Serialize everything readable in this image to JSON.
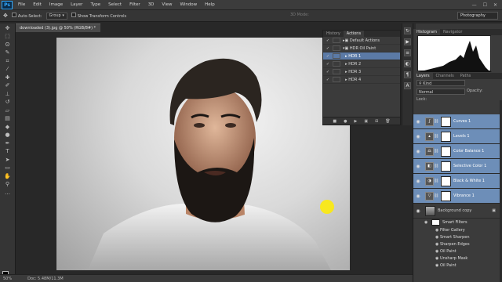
{
  "menubar": {
    "logo": "Ps",
    "items": [
      "File",
      "Edit",
      "Image",
      "Layer",
      "Type",
      "Select",
      "Filter",
      "3D",
      "View",
      "Window",
      "Help"
    ],
    "window_controls": [
      "—",
      "☐",
      "✕"
    ]
  },
  "options": {
    "auto_select": "Auto-Select:",
    "group_value": "Group",
    "transform_controls": "Show Transform Controls",
    "mode_3d": "3D Mode:",
    "workspace": "Photography"
  },
  "document": {
    "tab_title": "downloaded (3).jpg @ 50% (RGB/8#) *",
    "zoom": "50%",
    "doc_size": "Doc: 5.48M/11.3M"
  },
  "actions_panel": {
    "tabs": [
      "History",
      "Actions"
    ],
    "rows": [
      {
        "label": "Default Actions",
        "check": "✓",
        "selected": false
      },
      {
        "label": "HDR Oil Paint",
        "check": "✓",
        "selected": false
      },
      {
        "label": "HDR 1",
        "check": "✓",
        "selected": true
      },
      {
        "label": "HDR 2",
        "check": "✓",
        "selected": false
      },
      {
        "label": "HDR 3",
        "check": "✓",
        "selected": false
      },
      {
        "label": "HDR 4",
        "check": "✓",
        "selected": false
      }
    ]
  },
  "histogram_panel": {
    "tabs": [
      "Histogram",
      "Navigator"
    ]
  },
  "layers_panel": {
    "tabs": [
      "Layers",
      "Channels",
      "Paths"
    ],
    "filter_kind": "Kind",
    "blend_mode": "Normal",
    "opacity_label": "Opacity:",
    "lock_label": "Lock:",
    "layers": [
      {
        "name": "Curves 1",
        "selected": true
      },
      {
        "name": "Levels 1",
        "selected": true
      },
      {
        "name": "Color Balance 1",
        "selected": true
      },
      {
        "name": "Selective Color 1",
        "selected": true
      },
      {
        "name": "Black & White 1",
        "selected": true
      },
      {
        "name": "Vibrance 1",
        "selected": true
      },
      {
        "name": "Background copy",
        "selected": false
      }
    ],
    "smart_filters_label": "Smart Filters",
    "smart_filters": [
      "Filter Gallery",
      "Smart Sharpen",
      "Sharpen Edges",
      "Oil Paint",
      "Unsharp Mask",
      "Oil Paint"
    ]
  },
  "colors": {
    "accent": "#31a8ff",
    "selection": "#6d8eb8",
    "cursor": "#ffe600"
  }
}
